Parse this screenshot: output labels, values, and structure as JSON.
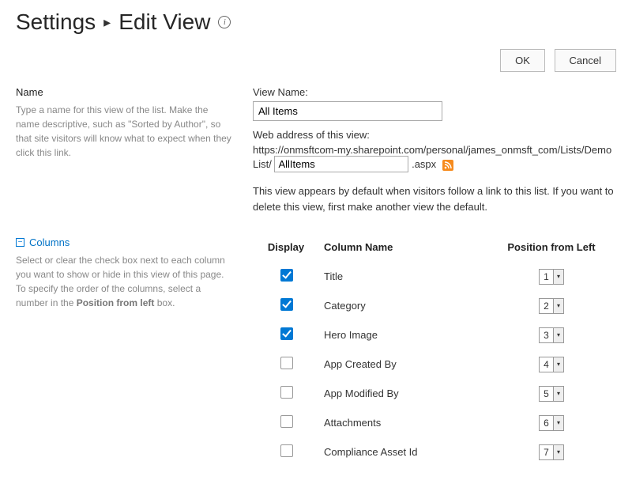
{
  "breadcrumb": {
    "parent": "Settings",
    "current": "Edit View"
  },
  "buttons": {
    "ok": "OK",
    "cancel": "Cancel"
  },
  "name_section": {
    "title": "Name",
    "desc": "Type a name for this view of the list. Make the name descriptive, such as \"Sorted by Author\", so that site visitors will know what to expect when they click this link.",
    "view_name_label": "View Name:",
    "view_name_value": "All Items",
    "web_addr_label": "Web address of this view:",
    "url_prefix": "https://onmsftcom-my.sharepoint.com/personal/james_onmsft_com/Lists/Demo List/",
    "file_value": "AllItems",
    "ext": ".aspx",
    "default_note": "This view appears by default when visitors follow a link to this list. If you want to delete this view, first make another view the default."
  },
  "columns_section": {
    "title": "Columns",
    "desc_pre": "Select or clear the check box next to each column you want to show or hide in this view of this page. To specify the order of the columns, select a number in the ",
    "desc_bold": "Position from left",
    "desc_post": " box.",
    "headers": {
      "display": "Display",
      "name": "Column Name",
      "pos": "Position from Left"
    },
    "rows": [
      {
        "checked": true,
        "name": "Title",
        "pos": "1"
      },
      {
        "checked": true,
        "name": "Category",
        "pos": "2"
      },
      {
        "checked": true,
        "name": "Hero Image",
        "pos": "3"
      },
      {
        "checked": false,
        "name": "App Created By",
        "pos": "4"
      },
      {
        "checked": false,
        "name": "App Modified By",
        "pos": "5"
      },
      {
        "checked": false,
        "name": "Attachments",
        "pos": "6"
      },
      {
        "checked": false,
        "name": "Compliance Asset Id",
        "pos": "7"
      }
    ]
  }
}
